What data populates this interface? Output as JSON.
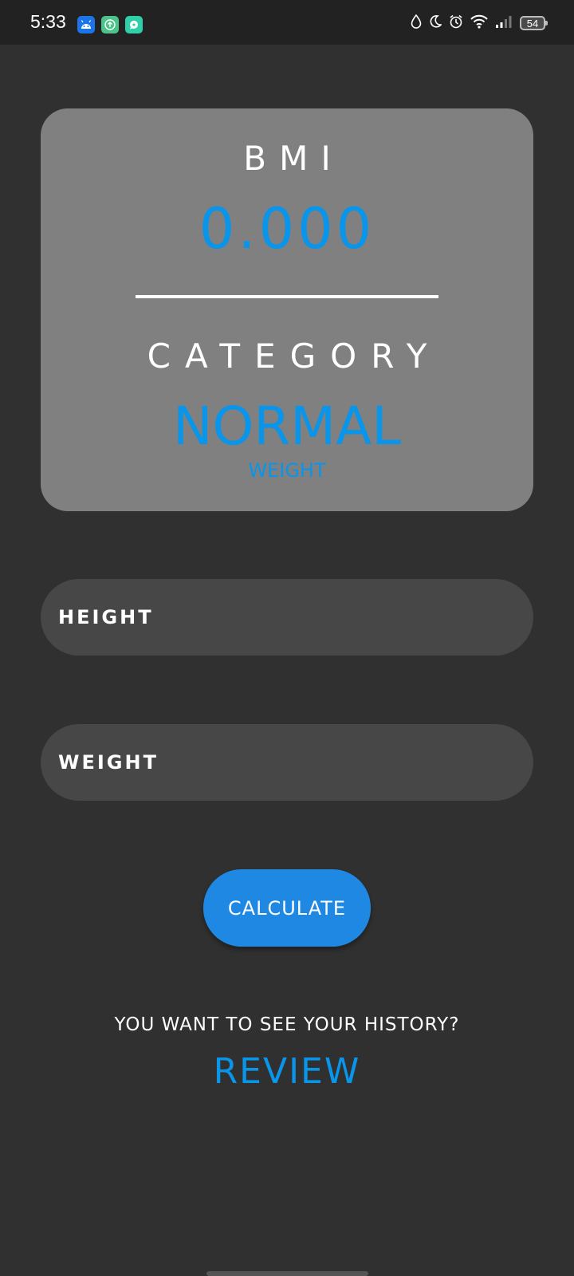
{
  "status_bar": {
    "time": "5:33",
    "battery": "54",
    "notification_icons": [
      "android-icon",
      "upload-app-icon",
      "chat-app-icon"
    ],
    "system_icons": [
      "water-drop-icon",
      "moon-icon",
      "alarm-icon",
      "wifi-icon",
      "signal-icon",
      "battery-icon"
    ]
  },
  "result": {
    "bmi_label": "BMI",
    "bmi_value": "0.000",
    "category_label": "CATEGORY",
    "category_value": "NORMAL",
    "category_sub": "WEIGHT"
  },
  "form": {
    "height_placeholder": "HEIGHT",
    "weight_placeholder": "WEIGHT",
    "calculate_label": "CALCULATE"
  },
  "history": {
    "question": "YOU WANT TO SEE YOUR HISTORY?",
    "review_label": "REVIEW"
  },
  "colors": {
    "background": "#303030",
    "status_bar": "#222222",
    "card": "#808080",
    "input": "#474747",
    "accent": "#0895ea",
    "button": "#1f88e2"
  }
}
